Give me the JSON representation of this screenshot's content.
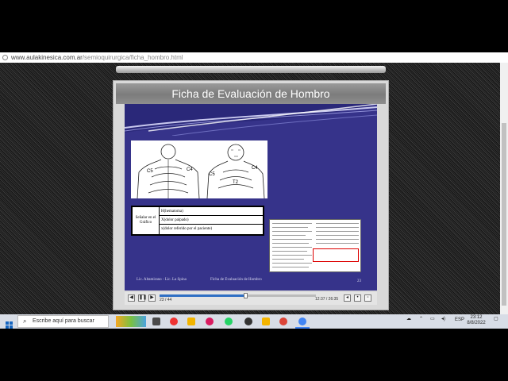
{
  "browser": {
    "url_host": "www.aulakinesica.com.ar",
    "url_path": "/semioquirurgica/ficha_hombro.html"
  },
  "player": {
    "title": "Ficha de Evaluación de Hombro",
    "slide_counter": "23 / 44",
    "time": "12:37 / 26:35",
    "progress": 0.55
  },
  "slide": {
    "diagram_labels": {
      "c5_left": "C5",
      "c4_left": "C4",
      "c5_right": "C5",
      "c4_right": "C4",
      "t2": "T2"
    },
    "legend": {
      "header": "Señalar en el Gráfico",
      "rows": [
        "H(hematoma)",
        "X(dolor palpado)",
        "x(dolor referido por el paciente)"
      ]
    },
    "footer_authors": "Lic. Altamirano - Lic. La Spina",
    "footer_title": "Ficha de Evaluación de Hombro",
    "slide_number": "23"
  },
  "taskbar": {
    "search_placeholder": "Escribe aquí para buscar",
    "language": "ESP",
    "clock_time": "23:12",
    "clock_date": "8/8/2022"
  },
  "colors": {
    "slide_bg": "#36338a",
    "progress": "#2f6fc4",
    "highlight": "#dd0000"
  }
}
